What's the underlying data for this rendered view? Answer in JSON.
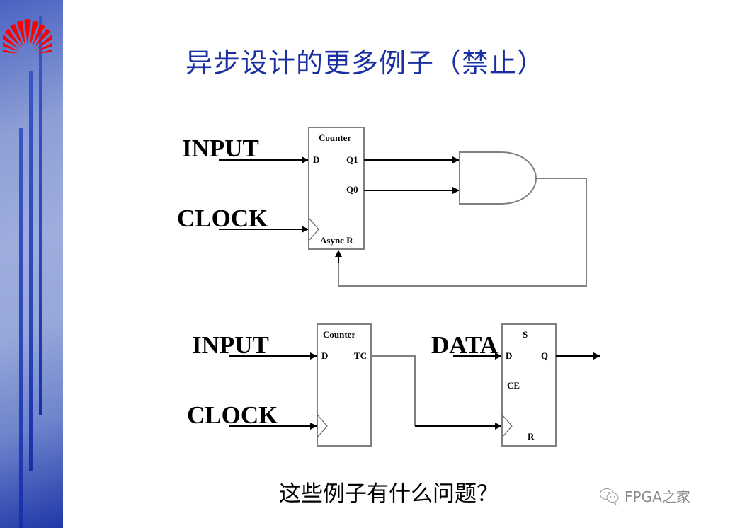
{
  "slide": {
    "title": "异步设计的更多例子（禁止）",
    "question": "这些例子有什么问题？",
    "watermark": {
      "icon": "wechat-icon",
      "text": "FPGA之家"
    },
    "colors": {
      "title": "#1a2fa0",
      "sidebar_dark": "#1f37a8",
      "sidebar_light": "#9eaddc",
      "logo": "#ff0000",
      "box_stroke": "#7f7f7f"
    }
  },
  "diagram1": {
    "input_label": "INPUT",
    "clock_label": "CLOCK",
    "counter": {
      "title": "Counter",
      "pin_d": "D",
      "pin_q1": "Q1",
      "pin_q0": "Q0",
      "pin_reset": "Async R"
    },
    "gate": "AND",
    "feedback": "AND output → Counter Async R"
  },
  "diagram2": {
    "input_label": "INPUT",
    "clock_label": "CLOCK",
    "data_label": "DATA",
    "counter": {
      "title": "Counter",
      "pin_d": "D",
      "pin_tc": "TC"
    },
    "flipflop": {
      "pin_s": "S",
      "pin_d": "D",
      "pin_q": "Q",
      "pin_ce": "CE",
      "pin_r": "R"
    },
    "connection": "Counter TC → flip-flop clock"
  }
}
